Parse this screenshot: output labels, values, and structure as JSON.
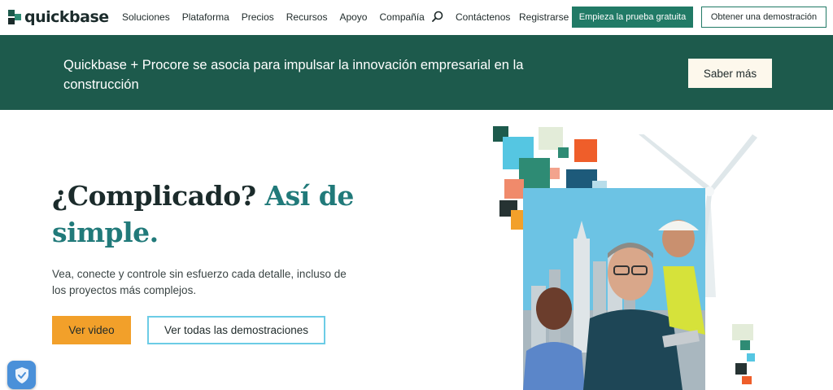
{
  "nav": {
    "logo_text": "quickbase",
    "links": [
      "Soluciones",
      "Plataforma",
      "Precios",
      "Recursos",
      "Apoyo",
      "Compañía"
    ],
    "contact": "Contáctenos",
    "register": "Registrarse",
    "trial_button": "Empieza la prueba gratuita",
    "demo_button": "Obtener una demostración"
  },
  "banner": {
    "text": "Quickbase + Procore se asocia para impulsar la innovación empresarial en la construcción",
    "button": "Saber más"
  },
  "hero": {
    "title_main": "¿Complicado?",
    "title_accent": "Así de simple.",
    "description": "Vea, conecte y controle sin esfuerzo cada detalle, incluso de los proyectos más complejos.",
    "video_button": "Ver video",
    "demos_button": "Ver todas las demostraciones"
  },
  "colors": {
    "brand_green": "#1d5a4c",
    "accent_green": "#217a66",
    "orange": "#f2a02a",
    "light_blue": "#6ccce6"
  },
  "icons": {
    "search": "search-icon",
    "privacy": "shield-icon"
  }
}
